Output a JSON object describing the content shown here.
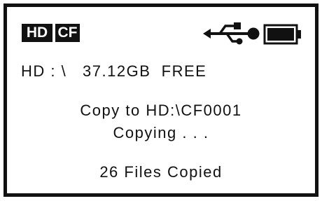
{
  "status_bar": {
    "drive_badge": "HD",
    "card_badge": "CF",
    "usb_icon": "usb-icon",
    "battery_icon": "battery-full-icon",
    "battery_level": 1.0
  },
  "storage": {
    "free_line": "HD : \\   37.12GB  FREE"
  },
  "copy": {
    "target_line": "Copy to HD:\\CF0001",
    "status_line": "Copying . . .",
    "result_line": "26 Files Copied"
  },
  "colors": {
    "foreground": "#111111",
    "background": "#ffffff"
  }
}
